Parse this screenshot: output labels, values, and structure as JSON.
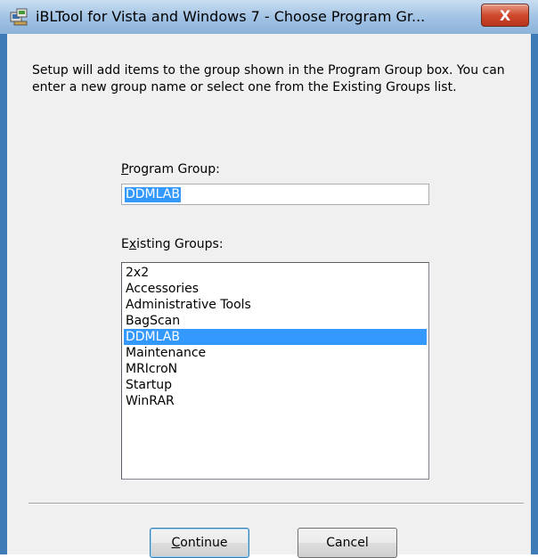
{
  "window": {
    "title": "iBLTool for Vista and Windows 7 - Choose Program Gr...",
    "close_glyph": "X",
    "title_icon": "setup-icon"
  },
  "description": "Setup will add items to the group shown in the Program Group box. You can enter a new group name or select one from the Existing Groups list.",
  "program_group": {
    "label_accel": "P",
    "label_rest": "rogram Group:",
    "value": "DDMLAB"
  },
  "existing_groups": {
    "label_first": "E",
    "label_accel": "x",
    "label_rest": "isting Groups:",
    "items": [
      "2x2",
      "Accessories",
      "Administrative Tools",
      "BagScan",
      "DDMLAB",
      "Maintenance",
      "MRIcroN",
      "Startup",
      "WinRAR"
    ],
    "selected": "DDMLAB"
  },
  "buttons": {
    "continue_accel": "C",
    "continue_rest": "ontinue",
    "cancel": "Cancel"
  },
  "colors": {
    "selection": "#3399ff",
    "close_button": "#cf4a2d",
    "title_bar": "#9fc1e3"
  }
}
